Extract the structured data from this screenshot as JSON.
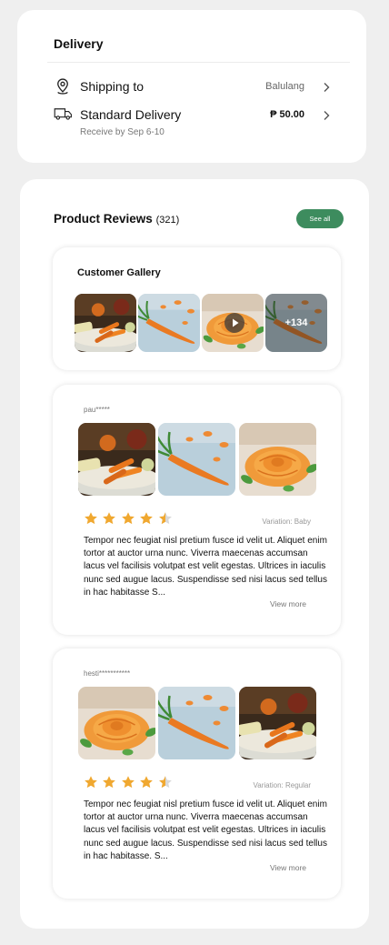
{
  "delivery": {
    "title": "Delivery",
    "shipping_label": "Shipping to",
    "shipping_value": "Balulang",
    "method_label": "Standard Delivery",
    "method_price": "₱ 50.00",
    "receive_note": "Receive by Sep 6-10"
  },
  "reviews": {
    "title": "Product Reviews",
    "count": "(321)",
    "see_all_label": "See all",
    "gallery": {
      "title": "Customer Gallery",
      "more_count": "+134"
    },
    "items": [
      {
        "username": "pau*****",
        "rating": 4.5,
        "variation": "Variation: Baby",
        "text": "Tempor nec feugiat nisl pretium fusce id velit ut. Aliquet enim tortor at auctor urna nunc. Viverra maecenas accumsan lacus vel facilisis volutpat est velit egestas. Ultrices in iaculis nunc sed augue lacus. Suspendisse sed nisi lacus sed tellus in hac habitasse S...",
        "view_more": "View more"
      },
      {
        "username": "hesti***********",
        "rating": 4.5,
        "variation": "Variation: Regular",
        "text": "Tempor nec feugiat nisl pretium fusce id velit ut. Aliquet enim tortor at auctor urna nunc. Viverra maecenas accumsan lacus vel facilisis volutpat est velit egestas. Ultrices in iaculis nunc sed augue lacus. Suspendisse sed nisi lacus sed tellus in hac habitasse. S...",
        "view_more": "View more"
      }
    ]
  },
  "colors": {
    "accent": "#3d8c5e",
    "star": "#f0a830",
    "page_bg": "#efefef"
  },
  "icons": {
    "location": "location-pin-icon",
    "truck": "truck-icon",
    "chevron": "chevron-right-icon",
    "play": "play-icon",
    "star": "star-icon"
  }
}
